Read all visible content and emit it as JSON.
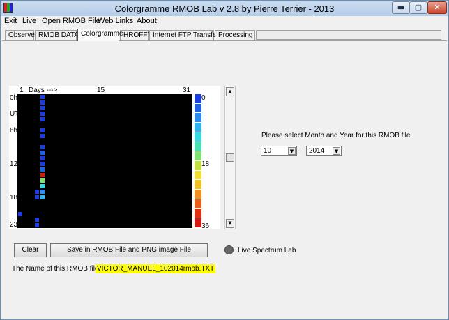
{
  "window": {
    "title": "Colorgramme RMOB Lab v 2.8  by Pierre Terrier  -  2013",
    "minimize_glyph": "▬",
    "maximize_glyph": "▢",
    "close_glyph": "✕",
    "icon": "app-icon"
  },
  "menu": [
    "Exit",
    "Live",
    "Open RMOB File",
    "Web Links",
    "About"
  ],
  "tabs": [
    {
      "label": "Observer",
      "active": false
    },
    {
      "label": "RMOB DATA",
      "active": false
    },
    {
      "label": "Colorgramme",
      "active": true
    },
    {
      "label": "HROFFT",
      "active": false
    },
    {
      "label": "Internet FTP Transfer",
      "active": false
    },
    {
      "label": "Processing",
      "active": false
    }
  ],
  "colorgramme": {
    "day_start": "1",
    "days_label": "Days --->",
    "day_mid": "15",
    "day_end": "31",
    "hour_labels": [
      "0h",
      "UT",
      "6h",
      "12",
      "18",
      "23"
    ],
    "scale_labels": [
      "0",
      "18",
      "36"
    ],
    "scale_colors": [
      "#1c3ee0",
      "#1f62e8",
      "#2a8cf0",
      "#30b4f0",
      "#38d8e0",
      "#48e0b0",
      "#80e070",
      "#c0e040",
      "#f0e030",
      "#f0c028",
      "#f09020",
      "#e86018",
      "#e03010",
      "#d81810"
    ],
    "cells": [
      {
        "day": 4,
        "hour": 0,
        "color": "#1c3ee0"
      },
      {
        "day": 4,
        "hour": 1,
        "color": "#1c3ee0"
      },
      {
        "day": 4,
        "hour": 2,
        "color": "#1c3ee0"
      },
      {
        "day": 4,
        "hour": 3,
        "color": "#1c3ee0"
      },
      {
        "day": 4,
        "hour": 4,
        "color": "#1c3ee0"
      },
      {
        "day": 4,
        "hour": 6,
        "color": "#1c3ee0"
      },
      {
        "day": 4,
        "hour": 7,
        "color": "#1c3ee0"
      },
      {
        "day": 4,
        "hour": 9,
        "color": "#1c3ee0"
      },
      {
        "day": 4,
        "hour": 10,
        "color": "#1f62e8"
      },
      {
        "day": 4,
        "hour": 11,
        "color": "#1c3ee0"
      },
      {
        "day": 4,
        "hour": 12,
        "color": "#1c3ee0"
      },
      {
        "day": 4,
        "hour": 13,
        "color": "#1f62e8"
      },
      {
        "day": 4,
        "hour": 14,
        "color": "#d81810"
      },
      {
        "day": 4,
        "hour": 15,
        "color": "#80e070"
      },
      {
        "day": 4,
        "hour": 16,
        "color": "#38d8e0"
      },
      {
        "day": 4,
        "hour": 17,
        "color": "#2a8cf0"
      },
      {
        "day": 4,
        "hour": 18,
        "color": "#30b4f0"
      },
      {
        "day": 3,
        "hour": 17,
        "color": "#1c3ee0"
      },
      {
        "day": 3,
        "hour": 18,
        "color": "#1c3ee0"
      },
      {
        "day": 0,
        "hour": 21,
        "color": "#1c3ee0"
      },
      {
        "day": 3,
        "hour": 22,
        "color": "#1c3ee0"
      },
      {
        "day": 3,
        "hour": 23,
        "color": "#1c3ee0"
      }
    ]
  },
  "select_prompt": "Please select Month and Year for this RMOB file",
  "month": {
    "value": "10"
  },
  "year": {
    "value": "2014"
  },
  "buttons": {
    "clear": "Clear",
    "save": "Save in RMOB File  and  PNG image File"
  },
  "live_spectrum_label": "Live Spectrum Lab",
  "file_name_label": "The Name of this RMOB file is :",
  "file_name_value": "VICTOR_MANUEL_102014rmob.TXT"
}
